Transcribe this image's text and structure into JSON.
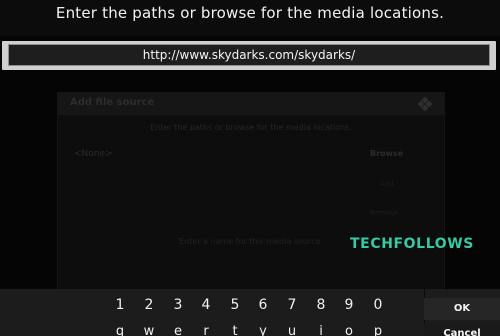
{
  "header": {
    "prompt": "Enter the paths or browse for the media locations."
  },
  "url_input": {
    "value": "http://www.skydarks.com/skydarks/"
  },
  "background_dialog": {
    "title": "Add file source",
    "subtitle": "Enter the paths or browse for the media locations.",
    "path_placeholder": "<None>",
    "browse_label": "Browse",
    "add_label": "Add",
    "remove_label": "Remove",
    "name_prompt": "Enter a name for this media source."
  },
  "watermark": {
    "text": "TECHFOLLOWS",
    "color": "#36c9a3"
  },
  "keyboard": {
    "number_keys": [
      "1",
      "2",
      "3",
      "4",
      "5",
      "6",
      "7",
      "8",
      "9",
      "0"
    ],
    "letter_keys": [
      "q",
      "w",
      "e",
      "r",
      "t",
      "y",
      "u",
      "i",
      "o",
      "p"
    ],
    "ok_label": "OK",
    "cancel_label": "Cancel"
  },
  "colors": {
    "background": "#050505",
    "input_frame": "#cfcfcf",
    "keyboard_panel": "#1c1c1c",
    "accent": "#36c9a3"
  }
}
